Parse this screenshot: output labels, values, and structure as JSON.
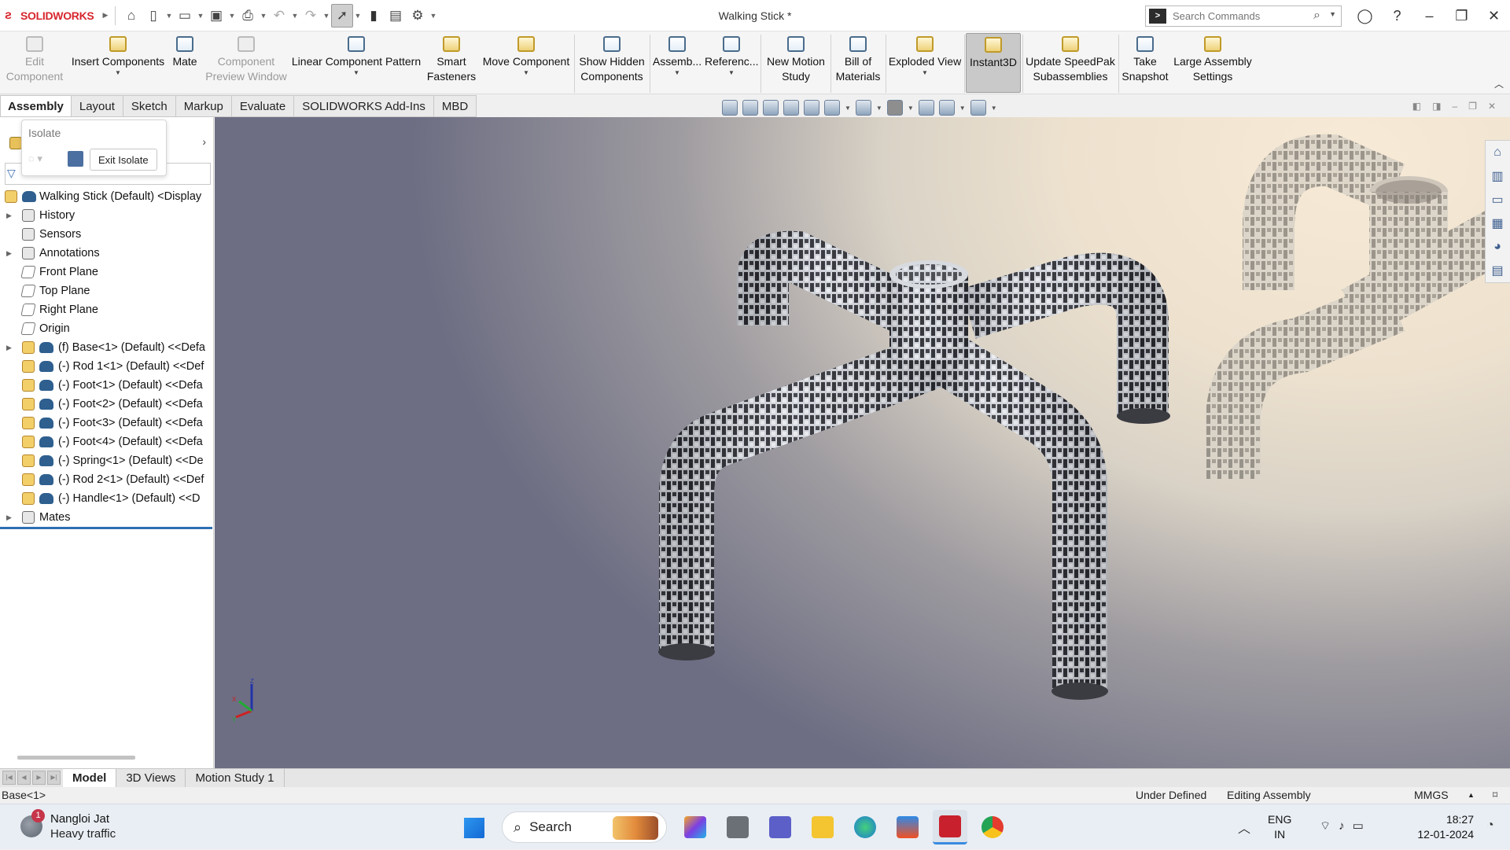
{
  "app": {
    "brand": "SOLIDWORKS",
    "document_title": "Walking Stick *",
    "search_placeholder": "Search Commands",
    "accent_color": "#d7262d"
  },
  "command_manager": {
    "edit_component": "Edit Component",
    "insert_components": "Insert Components",
    "mate": "Mate",
    "component_preview": "Component Preview Window",
    "linear_pattern": "Linear Component Pattern",
    "smart_fasteners": "Smart Fasteners",
    "move_component": "Move Component",
    "show_hidden": "Show Hidden Components",
    "assembly": "Assemb...",
    "reference": "Referenc...",
    "motion_study": "New Motion Study",
    "bom": "Bill of Materials",
    "exploded_view": "Exploded View",
    "instant3d": "Instant3D",
    "speedpak": "Update SpeedPak Subassemblies",
    "snapshot": "Take Snapshot",
    "large_assembly": "Large Assembly Settings"
  },
  "tabs": [
    "Assembly",
    "Layout",
    "Sketch",
    "Markup",
    "Evaluate",
    "SOLIDWORKS Add-Ins",
    "MBD"
  ],
  "isolate_popup": {
    "title": "Isolate",
    "exit_label": "Exit Isolate"
  },
  "feature_tree": {
    "root": "Walking Stick (Default) <Display",
    "items": [
      {
        "label": "History",
        "expandable": true
      },
      {
        "label": "Sensors",
        "expandable": false
      },
      {
        "label": "Annotations",
        "expandable": true
      },
      {
        "label": "Front Plane",
        "expandable": false
      },
      {
        "label": "Top Plane",
        "expandable": false
      },
      {
        "label": "Right Plane",
        "expandable": false
      },
      {
        "label": "Origin",
        "expandable": false
      },
      {
        "label": "(f) Base<1> (Default) <<Defa",
        "expandable": true
      },
      {
        "label": "(-) Rod 1<1> (Default) <<Def",
        "expandable": false
      },
      {
        "label": "(-) Foot<1> (Default) <<Defa",
        "expandable": false
      },
      {
        "label": "(-) Foot<2> (Default) <<Defa",
        "expandable": false
      },
      {
        "label": "(-) Foot<3> (Default) <<Defa",
        "expandable": false
      },
      {
        "label": "(-) Foot<4> (Default) <<Defa",
        "expandable": false
      },
      {
        "label": "(-) Spring<1> (Default) <<De",
        "expandable": false
      },
      {
        "label": "(-) Rod 2<1> (Default) <<Def",
        "expandable": false
      },
      {
        "label": "(-) Handle<1> (Default) <<D",
        "expandable": false
      },
      {
        "label": "Mates",
        "expandable": true
      }
    ]
  },
  "bottom_tabs": [
    "Model",
    "3D Views",
    "Motion Study 1"
  ],
  "status": {
    "selection": "Base<1>",
    "definition": "Under Defined",
    "mode": "Editing Assembly",
    "units": "MMGS"
  },
  "taskbar": {
    "weather_title": "Nangloi Jat",
    "weather_sub": "Heavy traffic",
    "weather_badge": "1",
    "search_label": "Search",
    "lang1": "ENG",
    "lang2": "IN",
    "time": "18:27",
    "date": "12-01-2024"
  },
  "triad": {
    "x": "X",
    "y": "Y",
    "z": "Z"
  }
}
